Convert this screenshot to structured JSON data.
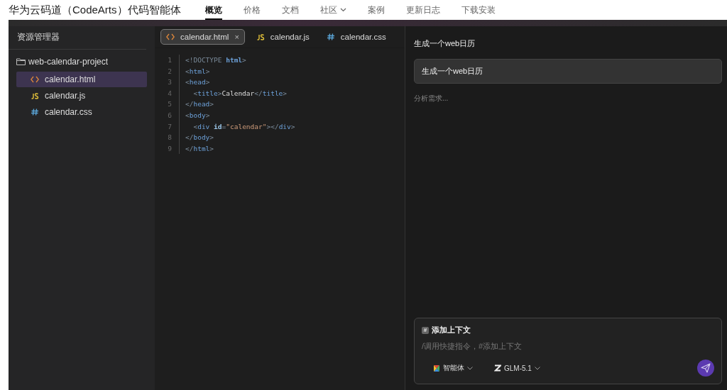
{
  "site": {
    "title": "华为云码道（CodeArts）代码智能体",
    "nav": [
      {
        "label": "概览",
        "selected": true,
        "dropdown": false
      },
      {
        "label": "价格",
        "selected": false,
        "dropdown": false
      },
      {
        "label": "文档",
        "selected": false,
        "dropdown": false
      },
      {
        "label": "社区",
        "selected": false,
        "dropdown": true
      },
      {
        "label": "案例",
        "selected": false,
        "dropdown": false
      },
      {
        "label": "更新日志",
        "selected": false,
        "dropdown": false
      },
      {
        "label": "下载安装",
        "selected": false,
        "dropdown": false
      }
    ]
  },
  "explorer": {
    "title": "资源管理器",
    "folder": "web-calendar-project",
    "files": [
      {
        "name": "calendar.html",
        "kind": "html",
        "selected": true
      },
      {
        "name": "calendar.js",
        "kind": "js",
        "selected": false
      },
      {
        "name": "calendar.css",
        "kind": "css",
        "selected": false
      }
    ]
  },
  "editor": {
    "tabs": [
      {
        "label": "calendar.html",
        "kind": "html",
        "selected": true,
        "close": "×"
      },
      {
        "label": "calendar.js",
        "kind": "js",
        "selected": false
      },
      {
        "label": "calendar.css",
        "kind": "css",
        "selected": false
      }
    ],
    "lines": [
      [
        {
          "kind": "punct",
          "text": "<!DOCTYPE "
        },
        {
          "kind": "keyword",
          "text": "html"
        },
        {
          "kind": "punct",
          "text": ">"
        }
      ],
      [
        {
          "kind": "punct",
          "text": "<"
        },
        {
          "kind": "tag",
          "text": "html"
        },
        {
          "kind": "punct",
          "text": ">"
        }
      ],
      [
        {
          "kind": "punct",
          "text": "<"
        },
        {
          "kind": "tag",
          "text": "head"
        },
        {
          "kind": "punct",
          "text": ">"
        }
      ],
      [
        {
          "kind": "indent"
        },
        {
          "kind": "punct",
          "text": "<"
        },
        {
          "kind": "tag",
          "text": "title"
        },
        {
          "kind": "punct",
          "text": ">"
        },
        {
          "kind": "plain",
          "text": "Calendar"
        },
        {
          "kind": "punct",
          "text": "</"
        },
        {
          "kind": "tag",
          "text": "title"
        },
        {
          "kind": "punct",
          "text": ">"
        }
      ],
      [
        {
          "kind": "punct",
          "text": "</"
        },
        {
          "kind": "tag",
          "text": "head"
        },
        {
          "kind": "punct",
          "text": ">"
        }
      ],
      [
        {
          "kind": "punct",
          "text": "<"
        },
        {
          "kind": "tag",
          "text": "body"
        },
        {
          "kind": "punct",
          "text": ">"
        }
      ],
      [
        {
          "kind": "indent"
        },
        {
          "kind": "punct",
          "text": "<"
        },
        {
          "kind": "tag",
          "text": "div"
        },
        {
          "kind": "attr",
          "text": "id"
        },
        {
          "kind": "punct",
          "text": "="
        },
        {
          "kind": "string",
          "text": "\"calendar\""
        },
        {
          "kind": "punct",
          "text": "></"
        },
        {
          "kind": "tag",
          "text": "div"
        },
        {
          "kind": "punct",
          "text": ">"
        }
      ],
      [
        {
          "kind": "punct",
          "text": "</"
        },
        {
          "kind": "tag",
          "text": "body"
        },
        {
          "kind": "punct",
          "text": ">"
        }
      ],
      [
        {
          "kind": "punct",
          "text": "</"
        },
        {
          "kind": "tag",
          "text": "html"
        },
        {
          "kind": "punct",
          "text": ">"
        }
      ]
    ],
    "line_numbers": [
      "1",
      "2",
      "3",
      "4",
      "5",
      "6",
      "7",
      "8",
      "9"
    ]
  },
  "chat": {
    "title": "生成一个web日历",
    "user_message": "生成一个web日历",
    "status": "分析需求...",
    "input": {
      "context_label": "添加上下文",
      "context_icon": "#",
      "placeholder": "/调用快捷指令，#添加上下文",
      "mode": "智能体",
      "model": "GLM-5.1"
    }
  }
}
